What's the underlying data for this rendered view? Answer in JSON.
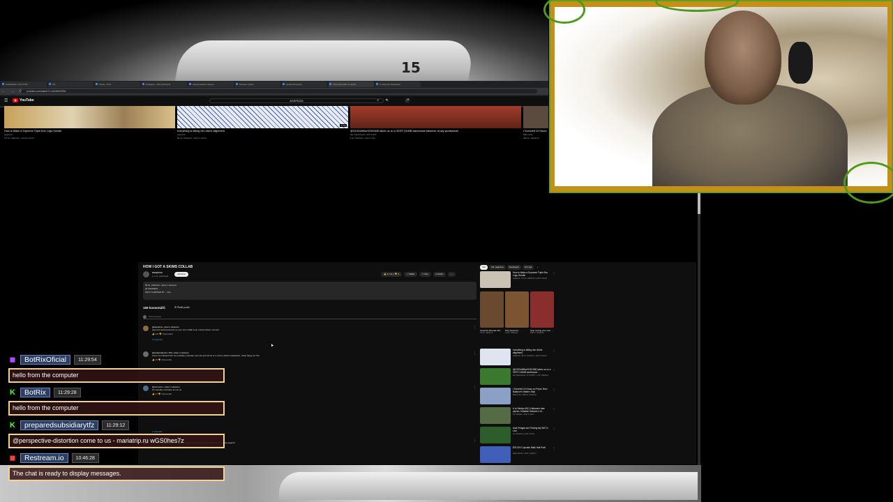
{
  "browser": {
    "tabs": [
      "UASOEVAC TCS OTOL",
      "Tbr",
      "Tamte - Tchs",
      "Twistpore - Nhs Grchmuzz",
      "mal ramestamc Gtuere",
      "Sunsine Unarw",
      "owuritt bltruscorp",
      "YHS-UNS CIET A UAHS",
      "CI Hecord | Newswork"
    ],
    "url": "youtube.com/watch?v=mbJfeNHRtA"
  },
  "youtube": {
    "logo": "YouTube",
    "search_query": "ASSPIZZA"
  },
  "rec_row": [
    {
      "title": "How to Make a Supreme Triple Box Logo Hoodie",
      "channel": "asspizza",
      "meta": "3,2 tis. zhlédnutí • před 3 měsíci",
      "duration": ""
    },
    {
      "title": "everything is falling into divine alignment.",
      "channel": "asspizza",
      "meta": "84 tis. zhlédnutí • před 3 měsíci",
      "duration": "17:01"
    },
    {
      "title": "@GODUMBorSOHOME takes us on a VERY DUMB warehouse takeover at sky sportswear!",
      "channel": "Sky Sportswear • KTCH DIT",
      "meta": "1,67 zhlédnutí • před 7 dny",
      "duration": ""
    },
    {
      "title": "I Survived 24 Hours",
      "channel": "Mike Gray",
      "meta": "382 tis. zhlédnutí",
      "duration": ""
    }
  ],
  "video": {
    "title": "HOW I GOT A SKIMS COLLAB",
    "channel": "asspizza",
    "subs": "1,1 mil. odběratelů",
    "join": "Odebírat",
    "likes": "1,7 tis.",
    "dislike": "0",
    "share": "Sdílet",
    "clip": "Klip",
    "save": "Uložit",
    "desc_line1": "59 tis. zhlédnutí • před 1 měsícem",
    "desc_line2": "@ ASSPIZZA",
    "desc_line3": "SHOT & EDITED BY ...více",
    "comments_count": "159 komentářů",
    "sort": "Řadit podle",
    "add_comment": "Okomentovat",
    "comments": [
      {
        "user": "@asspizza • před 1 měsícem",
        "text": "payment announcement on your own collab is an unreal culture moment",
        "likes": "183",
        "reply": "Odpovědět",
        "replies": "2 odpovědí"
      },
      {
        "user": "@AvilaCollection 150 • před 1 měsícem",
        "text": "crazy I've followed him for probably a decade now can just tell he is in such a better headspace, really happy for him",
        "likes": "35",
        "reply": "Odpovědět",
        "replies": ""
      },
      {
        "user": "@mrmaxim • před 1 měsícem",
        "text": "bro actually motivates af out me",
        "likes": "21",
        "reply": "Odpovědět",
        "replies": ""
      },
      {
        "user": "@Fmytherapper • před 1 měsícem",
        "text": "One of the realest artists of all time. Genuine and never goes off! Austin is a living legend!",
        "likes": "",
        "reply": "",
        "replies": "1 odpověď"
      }
    ],
    "side_chips": [
      "Vše",
      "Od: asspizza",
      "Související",
      "Pro vás"
    ],
    "side_items": [
      {
        "title": "How to Make a Supreme Triple Box Logo Hoodie",
        "meta": "asspizza • 3,2 tis. zhlédnutí • před 3 měsíci",
        "color": "#c9c2b5"
      },
      {
        "title": "everything is falling into divine alignment.",
        "meta": "asspizza • 84 tis. zhlédnutí • před 3 měsíci",
        "color": "#dfe5f0"
      },
      {
        "title": "@GODUMBorSOHOME takes us on a VERY DUMB warehouse ...",
        "meta": "Sky Sportswear • KTCH DIT • 1,67 zhlédnutí",
        "color": "#3a7a2e"
      },
      {
        "title": "I Survived 24 Hours on Pepsi: New Balance's Hidden Strip",
        "meta": "Mike Gray • 382 tis. zhlédnutí",
        "color": "#8aa0c4"
      },
      {
        "title": "A to Hledpe #52 | Hlaboraví darn pepsin, fotbalisti Ukázaní s dí...",
        "meta": "A to Hledpe • před 1 dnem",
        "color": "#556b45"
      },
      {
        "title": "Asia Pelagia and Finding My Will To Live",
        "meta": "Lex Fridman • před 1 dnem",
        "color": "#2c5d2a"
      },
      {
        "title": "$75,000 Cupcake Walk Hall Pratt",
        "meta": "Jake Kahnte • před 1 týdnem",
        "color": "#3f5fb8"
      }
    ],
    "shorts": [
      {
        "title": "Asspizza Reveals Wh...",
        "meta": "79 tis. zhlédnutí",
        "color": "#6a4a2e"
      },
      {
        "title": "Why Asspizza ...",
        "meta": "13 tis. zhlédnutí",
        "color": "#7b5531"
      },
      {
        "title": "Stop renting your own ...",
        "meta": "839 tis. zhlédnutí",
        "color": "#8a2d2d"
      }
    ]
  },
  "chat": {
    "messages": [
      {
        "user": "BotRixOficial",
        "time": "11:29:54",
        "text": "hello from the computer",
        "icon": "twitch-icon",
        "icon_color": "#b04bff"
      },
      {
        "user": "BotRix",
        "time": "11:29:28",
        "text": "hello from the computer",
        "icon": "kick-icon",
        "icon_color": "#53fc18"
      },
      {
        "user": "preparedsubsidiarytfz",
        "time": "11:29:12",
        "text": "@perspective-distortion come to us - mariatrip.ru wGS0hes7z",
        "icon": "kick-icon",
        "icon_color": "#53fc18"
      },
      {
        "user": "Restream.io",
        "time": "10:46:28",
        "text": "The chat is ready to display messages.",
        "icon": "restream-icon",
        "icon_color": "#ff3b3b"
      }
    ]
  },
  "colors": {
    "webcam_frame": "#c49018",
    "vine": "#4e9a1a",
    "chat_border": "#f3d29a",
    "chat_name_bg": "#2b3e63"
  }
}
